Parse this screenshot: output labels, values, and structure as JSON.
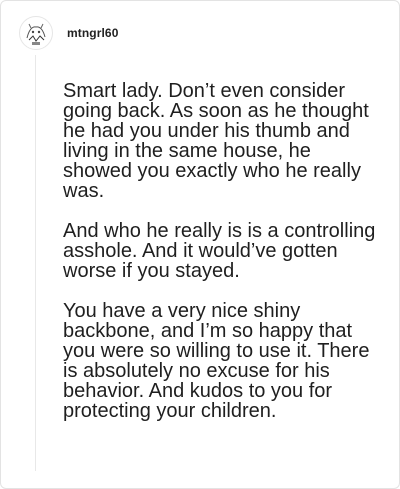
{
  "comment": {
    "username": "mtngrl60",
    "avatar_icon": "avatar-sketch-icon",
    "paragraphs": [
      "Smart lady. Don’t even consider going back. As soon as he thought he had you under his thumb and living in the same house, he showed you exactly who he really was.",
      "And who he really is is a controlling asshole. And it would’ve gotten worse if you stayed.",
      "You have a very nice shiny backbone, and I’m so happy that you were so willing to use it. There is absolutely no excuse for his behavior. And kudos to you for protecting your children."
    ]
  },
  "colors": {
    "text": "#1f1f1f",
    "username": "#222222",
    "border": "#e3e3e3"
  }
}
